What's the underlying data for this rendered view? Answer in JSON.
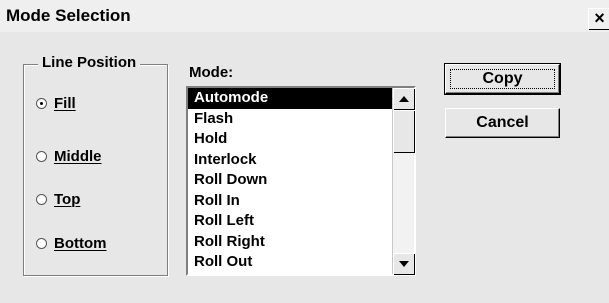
{
  "window": {
    "title": "Mode Selection",
    "close_glyph": "×"
  },
  "line_position": {
    "title": "Line Position",
    "options": [
      {
        "label": "Fill",
        "checked": true
      },
      {
        "label": "Middle",
        "checked": false
      },
      {
        "label": "Top",
        "checked": false
      },
      {
        "label": "Bottom",
        "checked": false
      }
    ]
  },
  "mode": {
    "caption": "Mode:",
    "selected": "Automode",
    "items": [
      "Automode",
      "Flash",
      "Hold",
      "Interlock",
      "Roll Down",
      "Roll In",
      "Roll Left",
      "Roll Right",
      "Roll Out"
    ]
  },
  "buttons": {
    "copy": "Copy",
    "cancel": "Cancel"
  },
  "colors": {
    "background": "#e7e7e7",
    "selection": "#000000"
  },
  "icons": {
    "close": "close-icon",
    "scroll_up": "scroll-up-arrow-icon",
    "scroll_down": "scroll-down-arrow-icon"
  }
}
